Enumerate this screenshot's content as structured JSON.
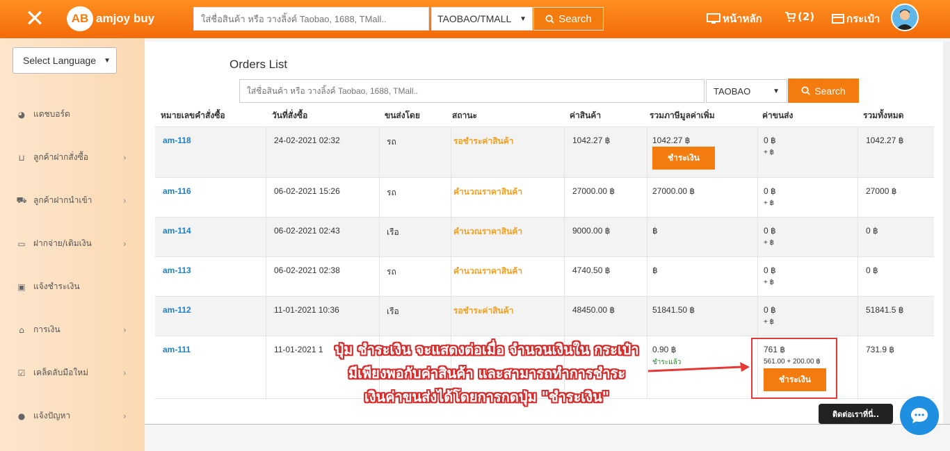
{
  "header": {
    "logo_mark": "AB",
    "logo_text": "amjoy buy",
    "search_placeholder": "ใส่ชื่อสินค้า หรือ วางลิ้งค์ Taobao, 1688, TMall..",
    "platform_selected": "TAOBAO/TMALL",
    "search_label": "Search",
    "home_label": "หน้าหลัก",
    "cart_label": "(2)",
    "wallet_label": "กระเป๋า"
  },
  "sidebar": {
    "language_label": "Select Language",
    "items": [
      {
        "label": "แดชบอร์ด",
        "icon": "dashboard-icon",
        "chevron": false
      },
      {
        "label": "ลูกค้าฝากสั่งซื้อ",
        "icon": "basket-icon",
        "chevron": true
      },
      {
        "label": "ลูกค้าฝากนำเข้า",
        "icon": "import-icon",
        "chevron": true
      },
      {
        "label": "ฝากจ่าย/เติมเงิน",
        "icon": "card-icon",
        "chevron": true
      },
      {
        "label": "แจ้งชำระเงิน",
        "icon": "money-icon",
        "chevron": false
      },
      {
        "label": "การเงิน",
        "icon": "bank-icon",
        "chevron": true
      },
      {
        "label": "เคล็ดลับมือใหม่",
        "icon": "checklist-icon",
        "chevron": true
      },
      {
        "label": "แจ้งปัญหา",
        "icon": "chat-icon",
        "chevron": true
      }
    ]
  },
  "orders": {
    "title": "Orders List",
    "search_placeholder": "ใส่ชื่อสินค้า หรือ วางลิ้งค์ Taobao, 1688, TMall..",
    "platform_selected": "TAOBAO",
    "search_label": "Search",
    "columns": [
      "หมายเลขคำสั่งซื้อ",
      "วันที่สั่งซื้อ",
      "ขนส่งโดย",
      "สถานะ",
      "ค่าสินค้า",
      "รวมภาษีมูลค่าเพิ่ม",
      "ค่าขนส่ง",
      "รวมทั้งหมด"
    ],
    "rows": [
      {
        "id": "am-118",
        "date": "24-02-2021 02:32",
        "ship": "รถ",
        "status": "รอชำระค่าสินค้า",
        "price": "1042.27 ฿",
        "vat": "1042.27 ฿",
        "shipping": "0 ฿",
        "shipping_sub": "+ ฿",
        "total": "1042.27 ฿",
        "pay_label": "ชำระเงิน"
      },
      {
        "id": "am-116",
        "date": "06-02-2021 15:26",
        "ship": "รถ",
        "status": "คำนวณราคาสินค้า",
        "price": "27000.00 ฿",
        "vat": "27000.00 ฿",
        "shipping": "0 ฿",
        "shipping_sub": "+ ฿",
        "total": "27000 ฿"
      },
      {
        "id": "am-114",
        "date": "06-02-2021 02:43",
        "ship": "เรือ",
        "status": "คำนวณราคาสินค้า",
        "price": "9000.00 ฿",
        "vat": "฿",
        "shipping": "0 ฿",
        "shipping_sub": "+ ฿",
        "total": "0 ฿"
      },
      {
        "id": "am-113",
        "date": "06-02-2021 02:38",
        "ship": "รถ",
        "status": "คำนวณราคาสินค้า",
        "price": "4740.50 ฿",
        "vat": "฿",
        "shipping": "0 ฿",
        "shipping_sub": "+ ฿",
        "total": "0 ฿"
      },
      {
        "id": "am-112",
        "date": "11-01-2021 10:36",
        "ship": "เรือ",
        "status": "รอชำระค่าสินค้า",
        "price": "48450.00 ฿",
        "vat": "51841.50 ฿",
        "shipping": "0 ฿",
        "shipping_sub": "+ ฿",
        "total": "51841.5 ฿"
      },
      {
        "id": "am-111",
        "date": "11-01-2021 1",
        "vat": "0.90 ฿",
        "paid_label": "ชำระแล้ว",
        "shipping": "761 ฿",
        "shipping_sub": "561.00 + 200.00 ฿",
        "total": "731.9 ฿",
        "pay_label": "ชำระเงิน"
      }
    ]
  },
  "annotation": {
    "line1": "ปุ่ม ชำระเงิน จะแสดงต่อเมื่อ จำนวนเงินใน กระเป๋า",
    "line2": "มีเพียงพอกับค่าสินค้า และสามารถทำการชำระ",
    "line3": "เงินค่าขนส่งได้โดยการกดปุ่ม \"ชำระเงิน\""
  },
  "chat": {
    "label": "ติดต่อเราที่นี่.."
  },
  "colors": {
    "accent": "#f47b0d",
    "link": "#1d7fc9",
    "status": "#f0a020",
    "annotation": "#d32f2f"
  }
}
